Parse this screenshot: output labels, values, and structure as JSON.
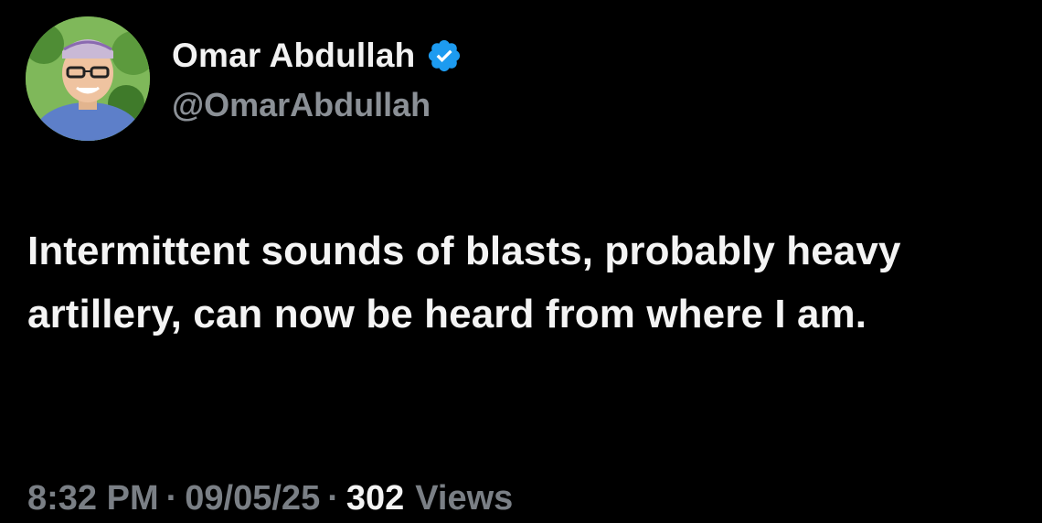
{
  "author": {
    "display_name": "Omar Abdullah",
    "handle": "@OmarAbdullah",
    "verified": true,
    "avatar_icon": "profile-photo-avatar"
  },
  "tweet": {
    "text": "Intermittent sounds of blasts, probably heavy artillery, can now be heard from where I am."
  },
  "meta": {
    "time": "8:32 PM",
    "separator": "·",
    "date": "09/05/25",
    "views_count": "302",
    "views_label": "Views"
  },
  "colors": {
    "background": "#000000",
    "primary_text": "#f4f4f4",
    "secondary_text": "#8b9096",
    "verified_badge": "#1d9bf0"
  }
}
